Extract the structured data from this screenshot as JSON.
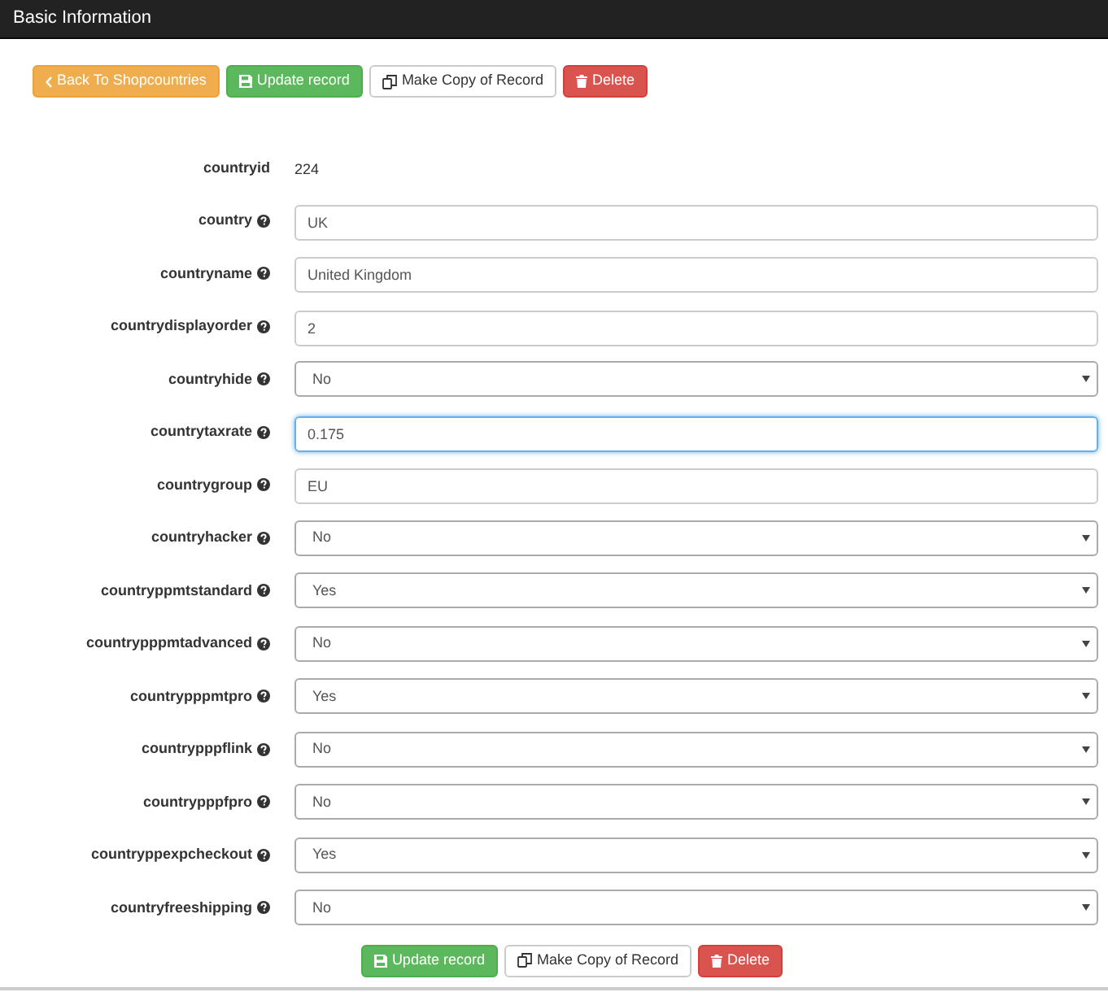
{
  "panel": {
    "title": "Basic Information"
  },
  "top_buttons": [
    {
      "kind": "back",
      "label": "Back To Shopcountries"
    },
    {
      "kind": "update",
      "label": "Update record"
    },
    {
      "kind": "copy",
      "label": "Make Copy of Record"
    },
    {
      "kind": "delete",
      "label": "Delete"
    }
  ],
  "fields": [
    {
      "label": "countryid",
      "kind": "static",
      "value": "224",
      "help": false
    },
    {
      "label": "country",
      "kind": "text",
      "value": "UK",
      "help": true,
      "focused": false
    },
    {
      "label": "countryname",
      "kind": "text",
      "value": "United Kingdom",
      "help": true,
      "focused": false
    },
    {
      "label": "countrydisplayorder",
      "kind": "text",
      "value": "2",
      "help": true,
      "focused": false
    },
    {
      "label": "countryhide",
      "kind": "select",
      "value": "No",
      "help": true
    },
    {
      "label": "countrytaxrate",
      "kind": "text",
      "value": "0.175",
      "help": true,
      "focused": true
    },
    {
      "label": "countrygroup",
      "kind": "text",
      "value": "EU",
      "help": true,
      "focused": false
    },
    {
      "label": "countryhacker",
      "kind": "select",
      "value": "No",
      "help": true
    },
    {
      "label": "countryppmtstandard",
      "kind": "select",
      "value": "Yes",
      "help": true
    },
    {
      "label": "countrypppmtadvanced",
      "kind": "select",
      "value": "No",
      "help": true
    },
    {
      "label": "countrypppmtpro",
      "kind": "select",
      "value": "Yes",
      "help": true
    },
    {
      "label": "countrypppflink",
      "kind": "select",
      "value": "No",
      "help": true
    },
    {
      "label": "countrypppfpro",
      "kind": "select",
      "value": "No",
      "help": true
    },
    {
      "label": "countryppexpcheckout",
      "kind": "select",
      "value": "Yes",
      "help": true
    },
    {
      "label": "countryfreeshipping",
      "kind": "select",
      "value": "No",
      "help": true
    }
  ],
  "bottom_buttons": [
    {
      "kind": "update",
      "label": "Update record"
    },
    {
      "kind": "copy",
      "label": "Make Copy of Record"
    },
    {
      "kind": "delete",
      "label": "Delete"
    }
  ]
}
